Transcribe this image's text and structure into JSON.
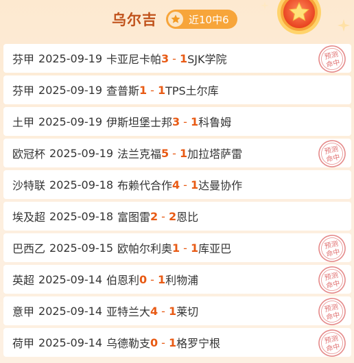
{
  "header": {
    "expert_name": "乌尔吉",
    "hit_label": "近10中6"
  },
  "stamp_text": "预测命中",
  "colors": {
    "score": "#e85a14",
    "accent": "#f7a53a",
    "title": "#c0521b"
  },
  "matches": [
    {
      "league": "芬甲",
      "date": "2025-09-19",
      "home": "卡亚尼卡帕",
      "home_score": "3",
      "sep": "-",
      "away_score": "1",
      "away": "SJK学院",
      "hit": true
    },
    {
      "league": "芬甲",
      "date": "2025-09-19",
      "home": "查普斯",
      "home_score": "1",
      "sep": "-",
      "away_score": "1",
      "away": "TPS土尔库",
      "hit": false
    },
    {
      "league": "土甲",
      "date": "2025-09-19",
      "home": "伊斯坦堡士邦",
      "home_score": "3",
      "sep": "-",
      "away_score": "1",
      "away": "科鲁姆",
      "hit": false
    },
    {
      "league": "欧冠杯",
      "date": "2025-09-19",
      "home": "法兰克福",
      "home_score": "5",
      "sep": "-",
      "away_score": "1",
      "away": "加拉塔萨雷",
      "hit": true
    },
    {
      "league": "沙特联",
      "date": "2025-09-18",
      "home": "布赖代合作",
      "home_score": "4",
      "sep": "-",
      "away_score": "1",
      "away": "达曼协作",
      "hit": false
    },
    {
      "league": "埃及超",
      "date": "2025-09-18",
      "home": "富图雷",
      "home_score": "2",
      "sep": "-",
      "away_score": "2",
      "away": "恩比",
      "hit": false
    },
    {
      "league": "巴西乙",
      "date": "2025-09-15",
      "home": "欧帕尔利奥",
      "home_score": "1",
      "sep": "-",
      "away_score": "1",
      "away": "库亚巴",
      "hit": true
    },
    {
      "league": "英超",
      "date": "2025-09-14",
      "home": "伯恩利",
      "home_score": "0",
      "sep": "-",
      "away_score": "1",
      "away": "利物浦",
      "hit": true
    },
    {
      "league": "意甲",
      "date": "2025-09-14",
      "home": "亚特兰大",
      "home_score": "4",
      "sep": "-",
      "away_score": "1",
      "away": "莱切",
      "hit": true
    },
    {
      "league": "荷甲",
      "date": "2025-09-14",
      "home": "乌德勒支",
      "home_score": "0",
      "sep": "-",
      "away_score": "1",
      "away": "格罗宁根",
      "hit": true
    }
  ]
}
